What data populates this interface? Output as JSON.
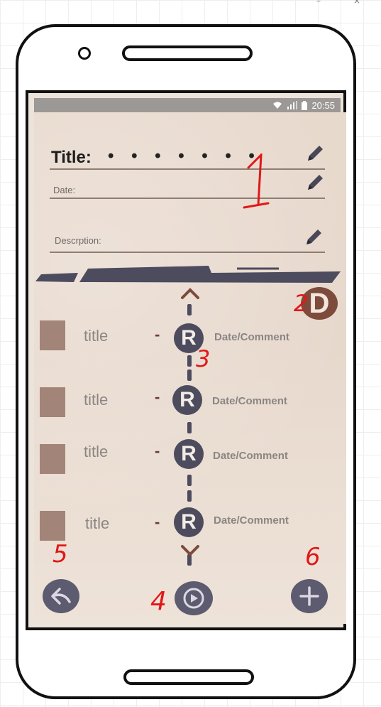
{
  "window_controls": {
    "minimize": "–",
    "close": "×"
  },
  "status_bar": {
    "time": "20:55"
  },
  "header": {
    "title_label": "Title:",
    "title_value": "• • • • • • •",
    "date_label": "Date:",
    "description_label": "Descrption:"
  },
  "timeline": {
    "marker_label": "R",
    "items": [
      {
        "title": "title",
        "dash": "-",
        "comment": "Date/Comment"
      },
      {
        "title": "title",
        "dash": "-",
        "comment": "Date/Comment"
      },
      {
        "title": "title",
        "dash": "-",
        "comment": "Date/Comment"
      },
      {
        "title": "title",
        "dash": "-",
        "comment": "Date/Comment"
      }
    ]
  },
  "d_button_label": "D",
  "annotations": [
    "1",
    "2",
    "3",
    "4",
    "5",
    "6"
  ],
  "icons": {
    "edit": "pencil-icon",
    "back": "back-arrow-icon",
    "play": "play-icon",
    "add": "plus-icon",
    "scroll_up": "chevron-up-icon",
    "scroll_down": "chevron-down-icon"
  },
  "colors": {
    "paper": "#e8d9cd",
    "marker": "#4d4b5e",
    "accent_brown": "#7d4a3b",
    "thumb": "#a38478",
    "annotation": "#e01818"
  }
}
